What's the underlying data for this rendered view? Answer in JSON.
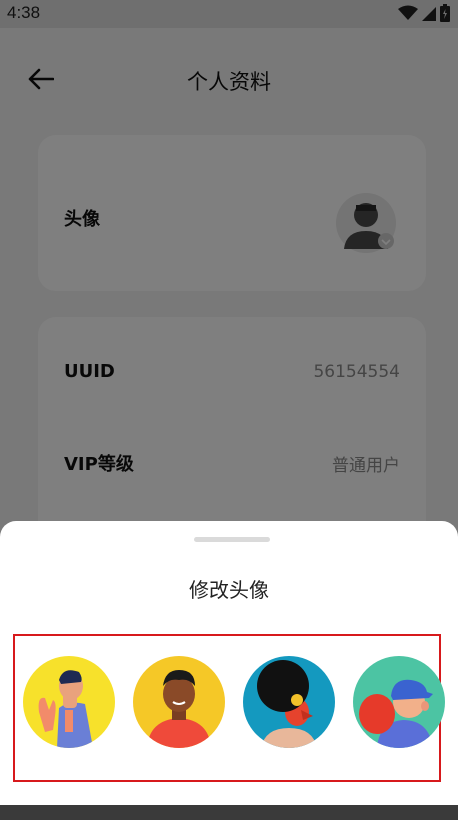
{
  "status_bar": {
    "time": "4:38"
  },
  "header": {
    "title": "个人资料"
  },
  "avatar_card": {
    "label": "头像"
  },
  "info_card": {
    "rows": [
      {
        "label": "UUID",
        "value": "56154554"
      },
      {
        "label": "VIP等级",
        "value": "普通用户"
      }
    ]
  },
  "sheet": {
    "title": "修改头像",
    "avatars": [
      {
        "name": "avatar-option-1",
        "bg": "#f7e12b"
      },
      {
        "name": "avatar-option-2",
        "bg": "#f5c827"
      },
      {
        "name": "avatar-option-3",
        "bg": "#1499bf"
      },
      {
        "name": "avatar-option-4",
        "bg": "#4cc4a3"
      }
    ]
  },
  "colors": {
    "highlight_border": "#d7191c",
    "overlay": "rgba(0,0,0,0.5)"
  }
}
